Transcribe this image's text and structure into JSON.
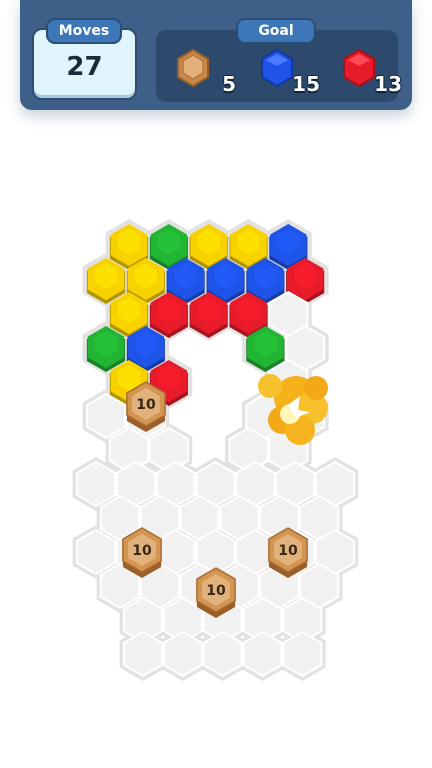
{
  "hud": {
    "moves_label": "Moves",
    "moves_value": "27",
    "goal_label": "Goal",
    "goals": [
      {
        "type": "wood",
        "count": "5"
      },
      {
        "type": "blue",
        "count": "15"
      },
      {
        "type": "red",
        "count": "13"
      }
    ]
  },
  "board": {
    "colors": {
      "yellow": "#f7d100",
      "green": "#22b533",
      "blue": "#1f54e8",
      "red": "#e81b2a",
      "empty": "#eeeeee",
      "wood": "#d39652"
    },
    "wood_label": "10"
  }
}
